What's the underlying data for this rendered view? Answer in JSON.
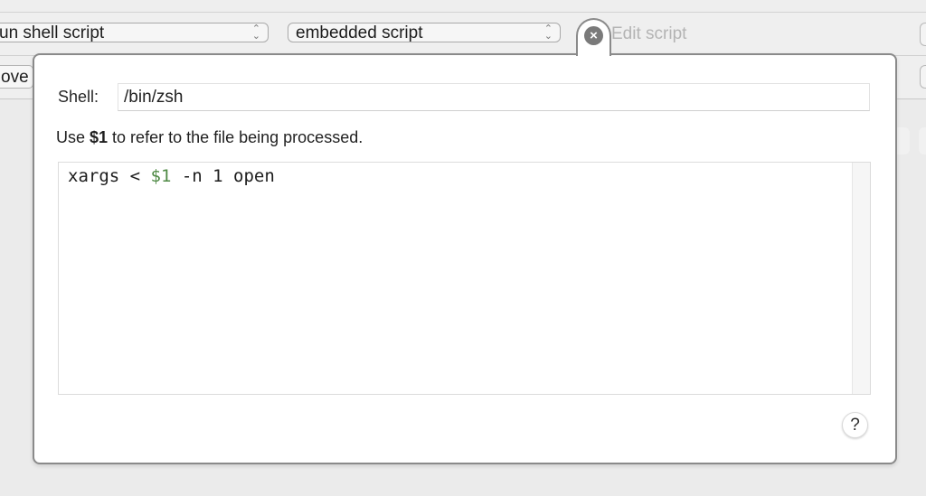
{
  "toolbar": {
    "action_popup": {
      "value": "Run shell script",
      "visible_text": "un shell script"
    },
    "source_popup": {
      "value": "embedded script"
    },
    "move_button_visible_text": "ove"
  },
  "editor_panel": {
    "tab": {
      "close_icon": "×",
      "label": "Edit script"
    },
    "shell": {
      "label": "Shell:",
      "value": "/bin/zsh"
    },
    "hint": {
      "prefix": "Use ",
      "variable": "$1",
      "suffix": " to refer to the file being processed."
    },
    "script": {
      "tokens": [
        {
          "text": "xargs < ",
          "type": "plain"
        },
        {
          "text": "$1",
          "type": "variable"
        },
        {
          "text": " -n 1 open",
          "type": "plain"
        }
      ],
      "variable_color": "#4f8a45"
    },
    "help_button": "?"
  }
}
